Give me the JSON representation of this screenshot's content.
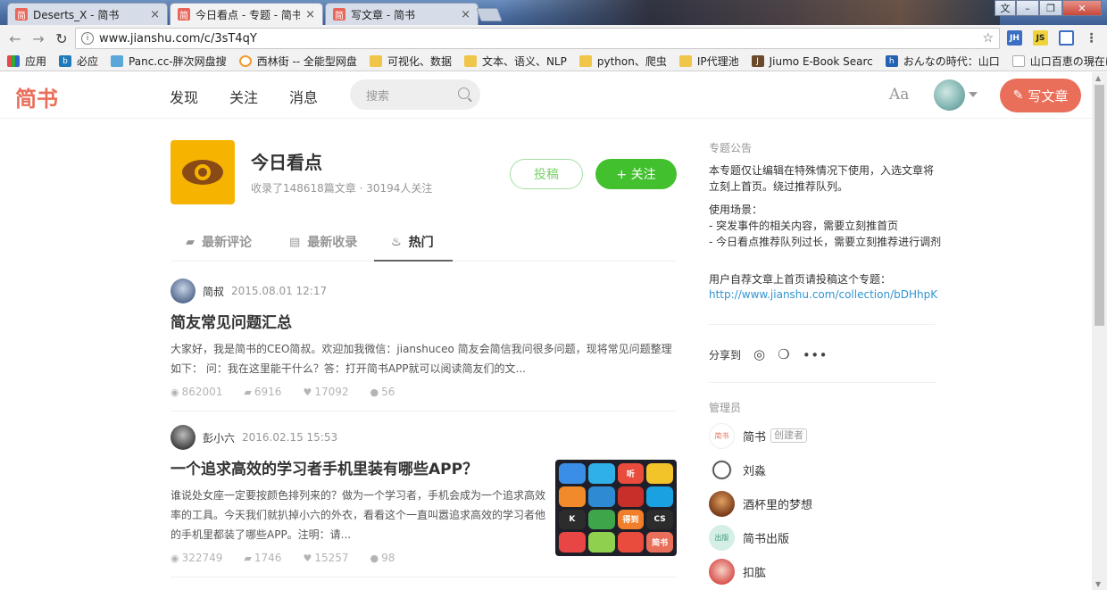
{
  "browser": {
    "tabs": [
      {
        "favicon": "简",
        "title": "Deserts_X - 简书",
        "close": "×"
      },
      {
        "favicon": "简",
        "title": "今日看点 - 专题 - 简书",
        "close": "×"
      },
      {
        "favicon": "简",
        "title": "写文章 - 简书",
        "close": "×"
      }
    ],
    "window_buttons": [
      "文",
      "–",
      "❐",
      "✕"
    ],
    "address": "www.jianshu.com/c/3sT4qY",
    "extensions": [
      "JH",
      "JS"
    ],
    "bookmarks": [
      {
        "icon": "apps-icon",
        "label": "应用"
      },
      {
        "icon": "bing-icon",
        "label": "必应"
      },
      {
        "icon": "panc-icon",
        "label": "Panc.cc-胖次网盘搜"
      },
      {
        "icon": "xilin-icon",
        "label": "西林街 -- 全能型网盘"
      },
      {
        "icon": "folder-icon",
        "label": "可视化、数据"
      },
      {
        "icon": "folder-icon",
        "label": "文本、语义、NLP"
      },
      {
        "icon": "folder-icon",
        "label": "python、爬虫"
      },
      {
        "icon": "folder-icon",
        "label": "IP代理池"
      },
      {
        "icon": "jiumo-icon",
        "label": "Jiumo E-Book Searc"
      },
      {
        "icon": "hatena-icon",
        "label": "おんなの時代：山口"
      },
      {
        "icon": "page-icon",
        "label": "山口百恵の現在は？"
      }
    ],
    "more_bookmarks": "»"
  },
  "header": {
    "logo": "简书",
    "nav": [
      "发现",
      "关注",
      "消息"
    ],
    "search_placeholder": "搜索",
    "font_toggle": "Aa",
    "write_label": "写文章"
  },
  "collection": {
    "title": "今日看点",
    "meta": "收录了148618篇文章 · 30194人关注",
    "submit_label": "投稿",
    "follow_label": "+ 关注",
    "tabs": [
      {
        "icon": "comment-icon",
        "label": "最新评论"
      },
      {
        "icon": "document-icon",
        "label": "最新收录"
      },
      {
        "icon": "fire-icon",
        "label": "热门"
      }
    ]
  },
  "articles": [
    {
      "author": "简叔",
      "time": "2015.08.01 12:17",
      "title": "简友常见问题汇总",
      "abstract": "大家好，我是简书的CEO简叔。欢迎加我微信：jianshuceo 简友会简信我问很多问题，现将常见问题整理如下： 问：我在这里能干什么？答：打开简书APP就可以阅读简友们的文...",
      "views": "862001",
      "comments": "6916",
      "likes": "17092",
      "rewards": "56"
    },
    {
      "author": "彭小六",
      "time": "2016.02.15 15:53",
      "title": "一个追求高效的学习者手机里装有哪些APP？",
      "abstract": "谁说处女座一定要按颜色排列来的？做为一个学习者，手机会成为一个追求高效率的工具。今天我们就扒掉小六的外衣，看看这个一直叫嚣追求高效的学习者他的手机里都装了哪些APP。注明：请...",
      "views": "322749",
      "comments": "1746",
      "likes": "15257",
      "rewards": "98",
      "thumb_apps": [
        "",
        "",
        "",
        "",
        "",
        "",
        "听",
        "",
        "K",
        "",
        "得到",
        "CS",
        "",
        "",
        "",
        "简书"
      ]
    }
  ],
  "sidebar": {
    "notice_label": "专题公告",
    "notice_lines": [
      "本专题仅让编辑在特殊情况下使用，入选文章将立刻上首页。绕过推荐队列。",
      "使用场景：",
      "- 突发事件的相关内容，需要立刻推首页",
      "- 今日看点推荐队列过长，需要立刻推荐进行调剂",
      "用户自荐文章上首页请投稿这个专题："
    ],
    "notice_link": "http://www.jianshu.com/collection/bDHhpK",
    "share_label": "分享到",
    "admin_label": "管理员",
    "admins": [
      {
        "name": "简书",
        "badge": "创建者"
      },
      {
        "name": "刘淼"
      },
      {
        "name": "酒杯里的梦想"
      },
      {
        "name": "简书出版"
      },
      {
        "name": "扣肱"
      }
    ]
  },
  "colors": {
    "brand": "#ea6f5a",
    "follow_green": "#42c02e",
    "link_blue": "#3194d0"
  }
}
